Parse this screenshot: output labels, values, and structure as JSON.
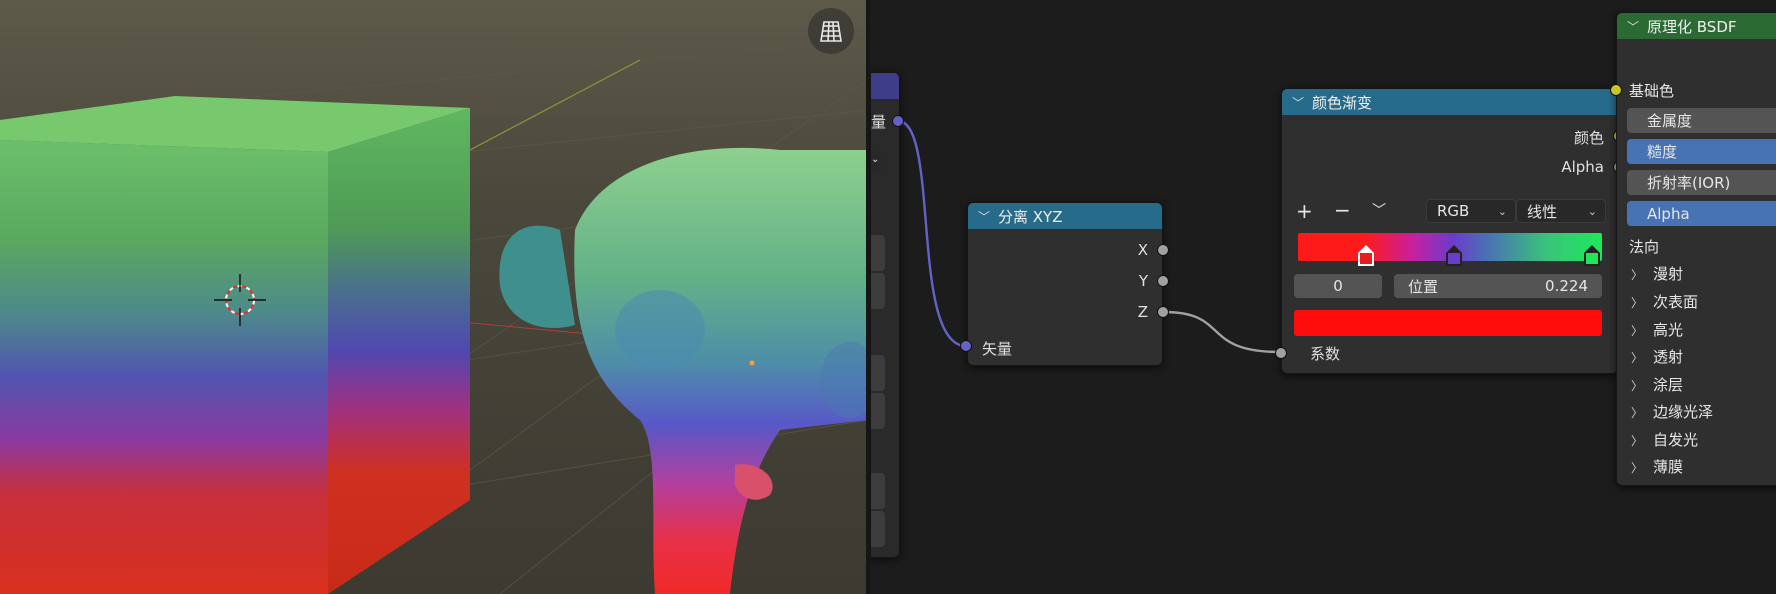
{
  "colors": {
    "node_header_blue": "#266b8a",
    "node_header_green": "#2c6a33",
    "vector_socket": "#6363c7",
    "float_socket": "#a1a1a1",
    "color_socket": "#c7c729",
    "selected_field": "#4772b3",
    "ramp_color": "#ff0d0d"
  },
  "viewport": {
    "grid_toggle_icon": "grid-view-icon"
  },
  "separate_xyz": {
    "title": "分离 XYZ",
    "outputs": [
      "X",
      "Y",
      "Z"
    ],
    "input": "矢量"
  },
  "partial_node": {
    "output_label": "量"
  },
  "color_ramp": {
    "title": "颜色渐变",
    "outputs": {
      "color": "颜色",
      "alpha": "Alpha"
    },
    "add_symbol": "+",
    "remove_symbol": "−",
    "color_mode": "RGB",
    "interpolation": "线性",
    "stop_index": "0",
    "position_label": "位置",
    "position_value": "0.224",
    "input": "系数"
  },
  "bsdf": {
    "title": "原理化 BSDF",
    "base_color": "基础色",
    "fields": [
      "金属度",
      "糙度",
      "折射率(IOR)",
      "Alpha"
    ],
    "normal": "法向",
    "sections": [
      "漫射",
      "次表面",
      "高光",
      "透射",
      "涂层",
      "边缘光泽",
      "自发光",
      "薄膜"
    ]
  }
}
